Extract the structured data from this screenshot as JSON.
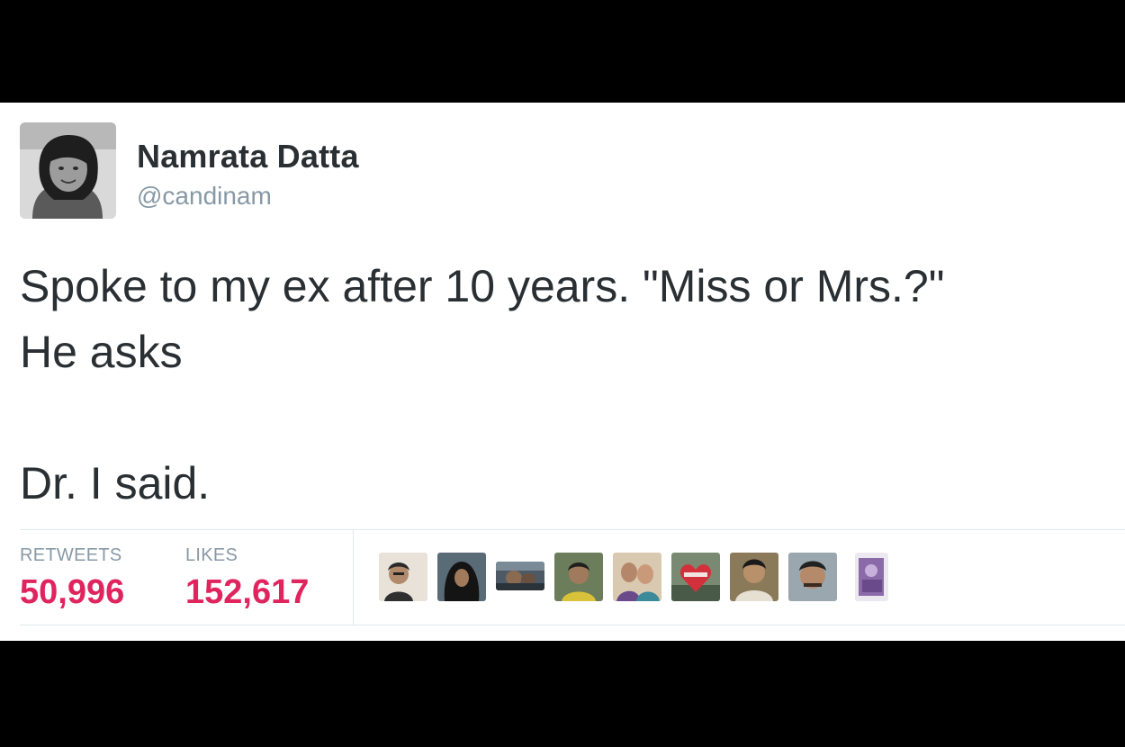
{
  "tweet": {
    "author_name": "Namrata Datta",
    "author_handle": "@candinam",
    "text_line_1": "Spoke to my ex after 10 years. \"Miss or Mrs.?\"",
    "text_line_2": "He asks",
    "text_line_3": "Dr. I said."
  },
  "stats": {
    "retweets_label": "RETWEETS",
    "retweets_value": "50,996",
    "likes_label": "LIKES",
    "likes_value": "152,617"
  },
  "colors": {
    "stat_value": "#e0245e",
    "secondary_text": "#8899a6",
    "primary_text": "#292f33"
  }
}
